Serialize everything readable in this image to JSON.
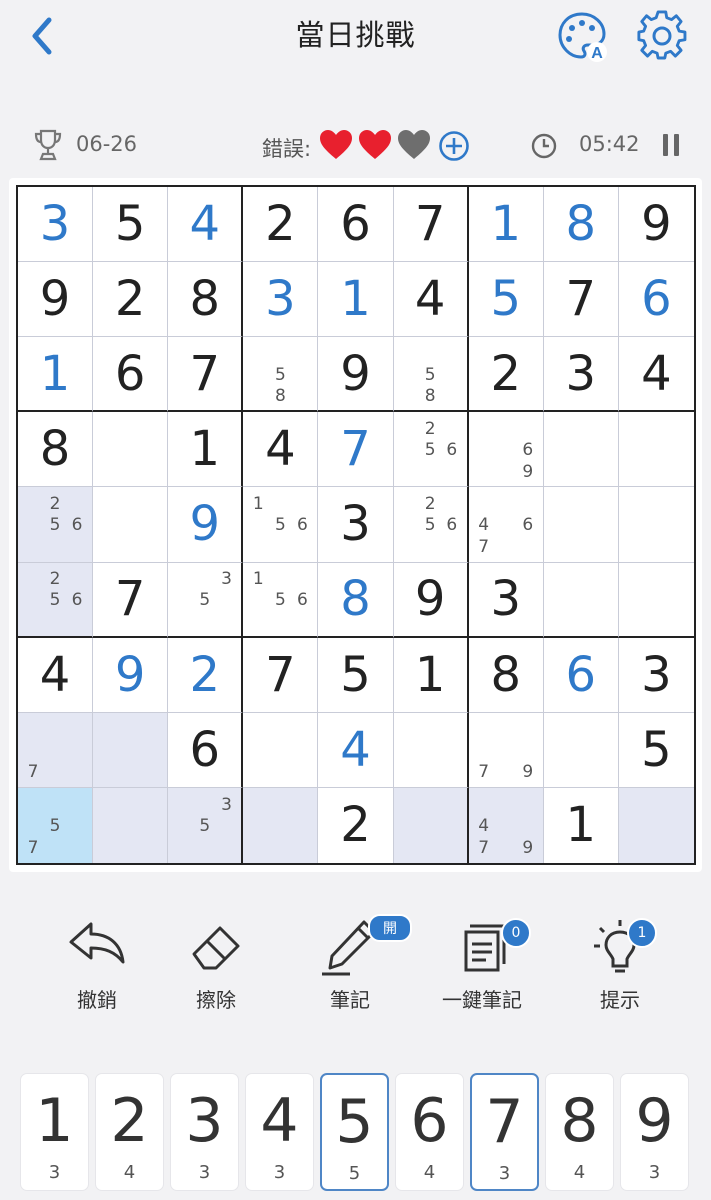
{
  "header": {
    "title": "當日挑戰"
  },
  "info": {
    "date": "06-26",
    "mistakes_label": "錯誤:",
    "lives": [
      true,
      true,
      false
    ],
    "timer": "05:42"
  },
  "board": {
    "cells": [
      [
        {
          "v": "3",
          "blue": true
        },
        {
          "v": "5"
        },
        {
          "v": "4",
          "blue": true
        },
        {
          "v": "2"
        },
        {
          "v": "6"
        },
        {
          "v": "7"
        },
        {
          "v": "1",
          "blue": true
        },
        {
          "v": "8",
          "blue": true
        },
        {
          "v": "9"
        }
      ],
      [
        {
          "v": "9"
        },
        {
          "v": "2"
        },
        {
          "v": "8"
        },
        {
          "v": "3",
          "blue": true
        },
        {
          "v": "1",
          "blue": true
        },
        {
          "v": "4"
        },
        {
          "v": "5",
          "blue": true
        },
        {
          "v": "7"
        },
        {
          "v": "6",
          "blue": true
        }
      ],
      [
        {
          "v": "1",
          "blue": true
        },
        {
          "v": "6"
        },
        {
          "v": "7"
        },
        {
          "n": [
            5,
            8
          ]
        },
        {
          "v": "9"
        },
        {
          "n": [
            5,
            8
          ]
        },
        {
          "v": "2"
        },
        {
          "v": "3"
        },
        {
          "v": "4"
        }
      ],
      [
        {
          "v": "8"
        },
        {},
        {
          "v": "1"
        },
        {
          "v": "4"
        },
        {
          "v": "7",
          "blue": true
        },
        {
          "n": [
            2,
            5,
            6
          ]
        },
        {
          "n": [
            6,
            9
          ]
        },
        {},
        {}
      ],
      [
        {
          "n": [
            2,
            5,
            6
          ]
        },
        {},
        {
          "v": "9",
          "blue": true
        },
        {
          "n": [
            1,
            5,
            6
          ]
        },
        {
          "v": "3"
        },
        {
          "n": [
            2,
            5,
            6
          ]
        },
        {
          "n": [
            4,
            6,
            7
          ]
        },
        {},
        {}
      ],
      [
        {
          "n": [
            2,
            5,
            6
          ]
        },
        {
          "v": "7"
        },
        {
          "n": [
            3,
            5
          ]
        },
        {
          "n": [
            1,
            5,
            6
          ]
        },
        {
          "v": "8",
          "blue": true
        },
        {
          "v": "9"
        },
        {
          "v": "3"
        },
        {},
        {}
      ],
      [
        {
          "v": "4"
        },
        {
          "v": "9",
          "blue": true
        },
        {
          "v": "2",
          "blue": true
        },
        {
          "v": "7"
        },
        {
          "v": "5"
        },
        {
          "v": "1"
        },
        {
          "v": "8"
        },
        {
          "v": "6",
          "blue": true
        },
        {
          "v": "3"
        }
      ],
      [
        {
          "n": [
            7
          ]
        },
        {},
        {
          "v": "6"
        },
        {},
        {
          "v": "4",
          "blue": true
        },
        {},
        {
          "n": [
            7,
            9
          ]
        },
        {},
        {
          "v": "5"
        }
      ],
      [
        {
          "n": [
            5,
            7
          ]
        },
        {},
        {
          "n": [
            3,
            5
          ]
        },
        {},
        {
          "v": "2"
        },
        {},
        {
          "n": [
            4,
            7,
            9
          ]
        },
        {
          "v": "1"
        },
        {}
      ]
    ],
    "selected": [
      8,
      0
    ]
  },
  "tools": [
    {
      "label": "撤銷",
      "icon": "undo-icon"
    },
    {
      "label": "擦除",
      "icon": "eraser-icon"
    },
    {
      "label": "筆記",
      "icon": "pencil-icon",
      "badge": "開"
    },
    {
      "label": "一鍵筆記",
      "icon": "auto-notes-icon",
      "badge": "0"
    },
    {
      "label": "提示",
      "icon": "lightbulb-icon",
      "badge": "1"
    }
  ],
  "numpad": [
    {
      "num": "1",
      "count": "3"
    },
    {
      "num": "2",
      "count": "4"
    },
    {
      "num": "3",
      "count": "3"
    },
    {
      "num": "4",
      "count": "3"
    },
    {
      "num": "5",
      "count": "5",
      "active": true
    },
    {
      "num": "6",
      "count": "4"
    },
    {
      "num": "7",
      "count": "3",
      "active": true
    },
    {
      "num": "8",
      "count": "4"
    },
    {
      "num": "9",
      "count": "3"
    }
  ],
  "colors": {
    "accent": "#2f79c9",
    "heart_full": "#e8202e",
    "heart_empty": "#6e6e6e",
    "highlight": "#e4e7f3",
    "selected": "#bfe2f7"
  }
}
